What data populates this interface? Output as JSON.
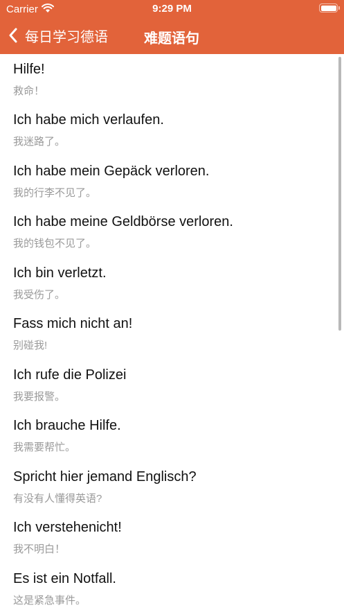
{
  "colors": {
    "accent": "#e2633a",
    "header_text": "#ffffff",
    "secondary_text": "#9a9a9a"
  },
  "status_bar": {
    "carrier": "Carrier",
    "time": "9:29 PM",
    "wifi_icon": "wifi-icon",
    "battery_icon": "battery-icon"
  },
  "nav": {
    "back_label": "每日学习德语",
    "back_icon": "chevron-left-icon",
    "title": "难题语句"
  },
  "phrases": [
    {
      "de": "Hilfe!",
      "zh": "救命！"
    },
    {
      "de": "Ich habe mich verlaufen.",
      "zh": "我迷路了。"
    },
    {
      "de": "Ich habe mein Gepäck verloren.",
      "zh": "我的行李不见了。"
    },
    {
      "de": "Ich habe meine Geldbörse verloren.",
      "zh": "我的钱包不见了。"
    },
    {
      "de": "Ich bin verletzt.",
      "zh": "我受伤了。"
    },
    {
      "de": "Fass mich nicht an!",
      "zh": "别碰我!"
    },
    {
      "de": "Ich rufe die Polizei",
      "zh": "我要报警。"
    },
    {
      "de": "Ich brauche Hilfe.",
      "zh": "我需要帮忙。"
    },
    {
      "de": "Spricht hier jemand Englisch?",
      "zh": "有没有人懂得英语?"
    },
    {
      "de": "Ich verstehenicht!",
      "zh": "我不明白！"
    },
    {
      "de": "Es ist ein Notfall.",
      "zh": "这是紧急事件。"
    }
  ]
}
